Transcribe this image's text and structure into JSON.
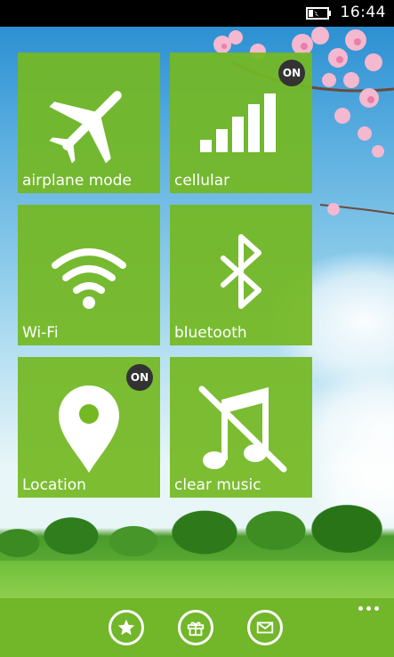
{
  "status_bar": {
    "time": "16:44",
    "battery_icon": "battery-charging-icon"
  },
  "tiles": [
    {
      "label": "airplane mode",
      "icon": "airplane-icon",
      "badge": ""
    },
    {
      "label": "cellular",
      "icon": "signal-bars-icon",
      "badge": "ON"
    },
    {
      "label": "Wi-Fi",
      "icon": "wifi-icon",
      "badge": ""
    },
    {
      "label": "bluetooth",
      "icon": "bluetooth-icon",
      "badge": ""
    },
    {
      "label": "Location",
      "icon": "location-pin-icon",
      "badge": "ON"
    },
    {
      "label": "clear music",
      "icon": "music-off-icon",
      "badge": ""
    }
  ],
  "app_bar": {
    "buttons": [
      "star-icon",
      "gift-icon",
      "mail-icon"
    ],
    "more_icon": "ellipsis-icon"
  },
  "colors": {
    "tile": "#74b822",
    "app_bar": "#72b62a",
    "badge": "#333333"
  }
}
